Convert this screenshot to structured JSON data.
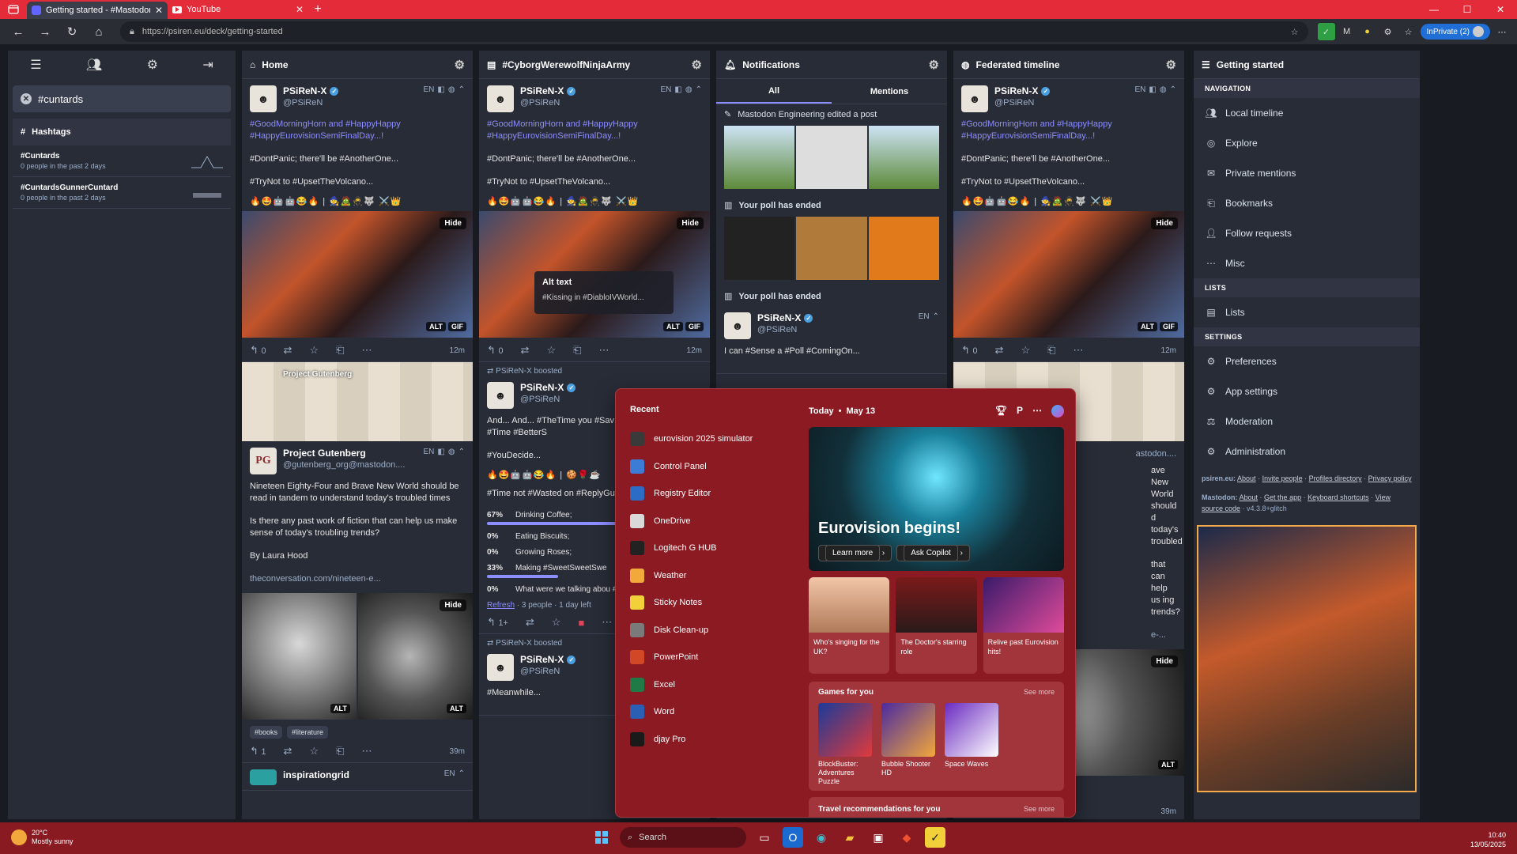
{
  "browser": {
    "tabs": [
      {
        "title": "Getting started - #MastodonSpy",
        "active": true
      },
      {
        "title": "YouTube",
        "active": false
      }
    ],
    "url": "https://psiren.eu/deck/getting-started",
    "inprivate_label": "InPrivate (2)"
  },
  "nav": {
    "active_hashtag": "#cuntards",
    "hashtags_heading": "Hashtags",
    "hashtags": [
      {
        "name": "#Cuntards",
        "stat": "0 people in the past 2 days"
      },
      {
        "name": "#CuntardsGunnerCuntard",
        "stat": "0 people in the past 2 days"
      }
    ]
  },
  "columns": {
    "home": {
      "title": "Home",
      "post1": {
        "name": "PSiReN-X",
        "handle": "@PSiReN",
        "lang": "EN",
        "p1": "#GoodMorningHorn and #HappyHappy #HappyEurovisionSemiFinalDay...!",
        "p2": "#DontPanic; there'll be #AnotherOne...",
        "p3": "#TryNot to #UpsetTheVolcano...",
        "replies": "0",
        "time": "12m"
      },
      "post2": {
        "card_label": "Project Gutenberg",
        "name": "Project Gutenberg",
        "handle": "@gutenberg_org@mastodon....",
        "lang": "EN",
        "p1": "Nineteen Eighty-Four and Brave New World should be read in tandem to understand today's troubled times",
        "p2": "Is there any past work of fiction that can help us make sense of today's troubling trends?",
        "p3": "By Laura Hood",
        "link": "theconversation.com/nineteen-e...",
        "tags": [
          "#books",
          "#literature"
        ],
        "replies": "1",
        "time": "39m"
      },
      "post3": {
        "name": "inspirationgrid",
        "lang": "EN"
      }
    },
    "ninja": {
      "title": "#CyborgWerewolfNinjaArmy",
      "post1": {
        "name": "PSiReN-X",
        "handle": "@PSiReN",
        "lang": "EN",
        "p1": "#GoodMorningHorn and #HappyHappy #HappyEurovisionSemiFinalDay...!",
        "p2": "#DontPanic; there'll be #AnotherOne...",
        "p3": "#TryNot to #UpsetTheVolcano...",
        "alt_title": "Alt text",
        "alt_body": "#Kissing in #DiabloIVWorld...",
        "replies": "0",
        "time": "12m"
      },
      "boost1": {
        "booster": "PSiReN-X",
        "boosted": "boosted",
        "name": "PSiReN-X",
        "handle": "@PSiReN",
        "p1": "And... And... #TheTime you #Sav #TimeWasters is #Time #BetterS",
        "p2": "#YouDecide...",
        "p3": "#Time not #Wasted on #ReplyGu [#SelectAllThatApply]",
        "poll": [
          {
            "pct": "67%",
            "label": "Drinking Coffee;",
            "value": 67
          },
          {
            "pct": "0%",
            "label": "Eating Biscuits;",
            "value": 0
          },
          {
            "pct": "0%",
            "label": "Growing Roses;",
            "value": 0
          },
          {
            "pct": "33%",
            "label": "Making #SweetSweetSwe",
            "value": 33
          },
          {
            "pct": "0%",
            "label": "What were we talking abou #WWWTAA",
            "value": 0
          }
        ],
        "refresh": "Refresh",
        "poll_meta": "· 3 people · 1 day left",
        "replies": "1+"
      },
      "boost2": {
        "booster": "PSiReN-X",
        "boosted": "boosted",
        "name": "PSiReN-X",
        "handle": "@PSiReN",
        "p1": "#Meanwhile..."
      }
    },
    "notifications": {
      "title": "Notifications",
      "tabs": [
        "All",
        "Mentions"
      ],
      "n1": "Mastodon Engineering edited a post",
      "n2": "Your poll has ended",
      "n3": "Your poll has ended",
      "post": {
        "name": "PSiReN-X",
        "handle": "@PSiReN",
        "lang": "EN",
        "p1": "I can #Sense a #Poll #ComingOn..."
      }
    },
    "federated": {
      "title": "Federated timeline",
      "post1": {
        "name": "PSiReN-X",
        "handle": "@PSiReN",
        "lang": "EN",
        "p1": "#GoodMorningHorn and #HappyHappy #HappyEurovisionSemiFinalDay...!",
        "p2": "#DontPanic; there'll be #AnotherOne...",
        "p3": "#TryNot to #UpsetTheVolcano...",
        "replies": "0",
        "time": "12m"
      },
      "post2": {
        "handle": "astodon....",
        "lang": "EN",
        "p1": "ave New World should d today's troubled",
        "p2": "that can help us ing trends?",
        "link": "e-...",
        "time": "39m"
      }
    },
    "getting_started": {
      "title": "Getting started",
      "navigation_heading": "NAVIGATION",
      "navigation": [
        "Local timeline",
        "Explore",
        "Private mentions",
        "Bookmarks",
        "Follow requests",
        "Misc"
      ],
      "lists_heading": "LISTS",
      "lists": [
        "Lists"
      ],
      "settings_heading": "SETTINGS",
      "settings": [
        "Preferences",
        "App settings",
        "Moderation",
        "Administration"
      ],
      "footer1_site": "psiren.eu:",
      "footer1_links": [
        "About",
        "Invite people",
        "Profiles directory",
        "Privacy policy"
      ],
      "footer2_site": "Mastodon:",
      "footer2_links": [
        "About",
        "Get the app",
        "Keyboard shortcuts",
        "View source code"
      ],
      "version": "v4.3.8+glitch"
    }
  },
  "start_menu": {
    "recent_heading": "Recent",
    "apps": [
      {
        "name": "eurovision 2025 simulator",
        "icon": "globe-icon",
        "color": "#3a3a3a"
      },
      {
        "name": "Control Panel",
        "icon": "control-panel-icon",
        "color": "#3c7bd6"
      },
      {
        "name": "Registry Editor",
        "icon": "registry-icon",
        "color": "#2d6cc4"
      },
      {
        "name": "OneDrive",
        "icon": "onedrive-icon",
        "color": "#d9d9d9"
      },
      {
        "name": "Logitech G HUB",
        "icon": "logitech-icon",
        "color": "#222222"
      },
      {
        "name": "Weather",
        "icon": "weather-icon",
        "color": "#f2a83a"
      },
      {
        "name": "Sticky Notes",
        "icon": "sticky-notes-icon",
        "color": "#f2d03a"
      },
      {
        "name": "Disk Clean-up",
        "icon": "disk-cleanup-icon",
        "color": "#7a7a7a"
      },
      {
        "name": "PowerPoint",
        "icon": "powerpoint-icon",
        "color": "#d24726"
      },
      {
        "name": "Excel",
        "icon": "excel-icon",
        "color": "#1f7a45"
      },
      {
        "name": "Word",
        "icon": "word-icon",
        "color": "#2b5fb4"
      },
      {
        "name": "djay Pro",
        "icon": "djay-icon",
        "color": "#1a1a1a"
      }
    ],
    "today": "Today",
    "date": "May 13",
    "hero_title": "Eurovision begins!",
    "learn_more": "Learn more",
    "ask_copilot": "Ask Copilot",
    "cards": [
      "Who's singing for the UK?",
      "The Doctor's starring role",
      "Relive past Eurovision hits!"
    ],
    "games_heading": "Games for you",
    "see_more": "See more",
    "games": [
      "BlockBuster: Adventures Puzzle",
      "Bubble Shooter HD",
      "Space Waves"
    ],
    "travel_heading": "Travel recommendations for you"
  },
  "taskbar": {
    "temp": "20°C",
    "condition": "Mostly sunny",
    "search_placeholder": "Search",
    "time": "10:40",
    "date": "13/05/2025"
  }
}
